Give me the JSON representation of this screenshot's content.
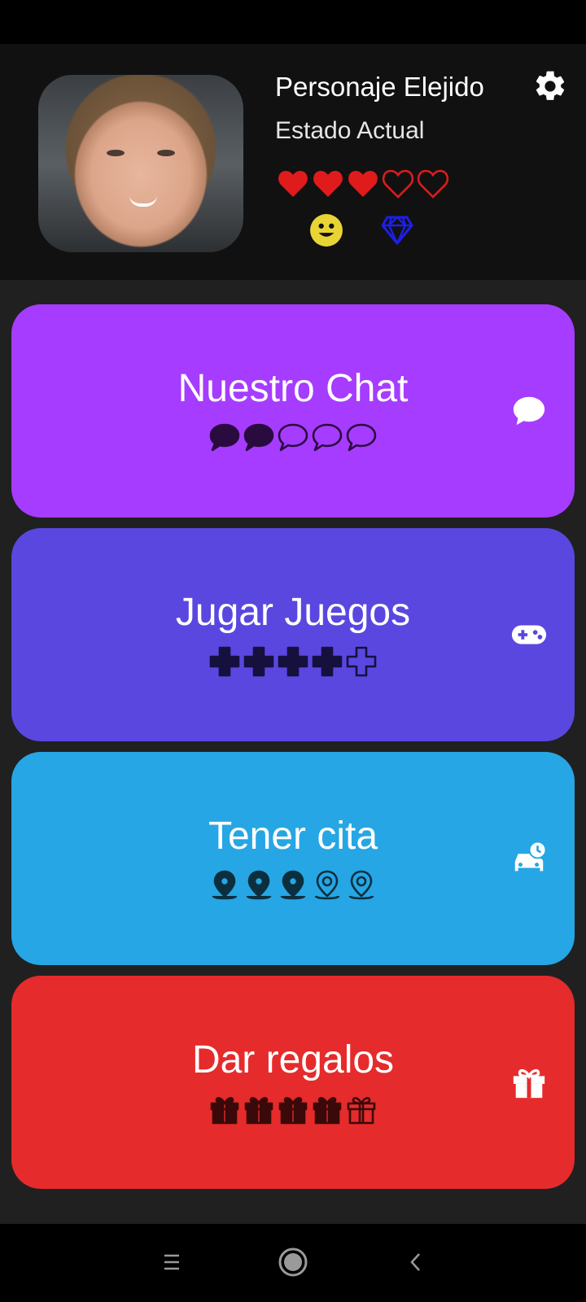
{
  "profile": {
    "name": "Personaje Elejido",
    "status": "Estado Actual",
    "hearts_filled": 3,
    "hearts_total": 5,
    "colors": {
      "heart": "#e01b1b",
      "smiley": "#e8d535",
      "gem": "#1e1ee8"
    }
  },
  "icons": {
    "settings": "gear-icon",
    "mood": "smiley-icon",
    "gem": "gem-icon"
  },
  "cards": [
    {
      "title": "Nuestro Chat",
      "icon": "chat-bubble-icon",
      "meter_icon": "speech-bubble",
      "meter_filled": 2,
      "meter_total": 5,
      "bg": "#a63cff",
      "meter_color": "#2a0b3f"
    },
    {
      "title": "Jugar Juegos",
      "icon": "gamepad-icon",
      "meter_icon": "plus-cross",
      "meter_filled": 4,
      "meter_total": 5,
      "bg": "#5a47e0",
      "meter_color": "#16103f"
    },
    {
      "title": "Tener cita",
      "icon": "car-clock-icon",
      "meter_icon": "map-pin",
      "meter_filled": 3,
      "meter_total": 5,
      "bg": "#26a6e4",
      "meter_color": "#0b2f3f"
    },
    {
      "title": "Dar regalos",
      "icon": "gift-icon",
      "meter_icon": "gift",
      "meter_filled": 4,
      "meter_total": 5,
      "bg": "#e52b2b",
      "meter_color": "#3a0909"
    }
  ],
  "nav": [
    "menu-icon",
    "home-icon",
    "back-icon"
  ]
}
